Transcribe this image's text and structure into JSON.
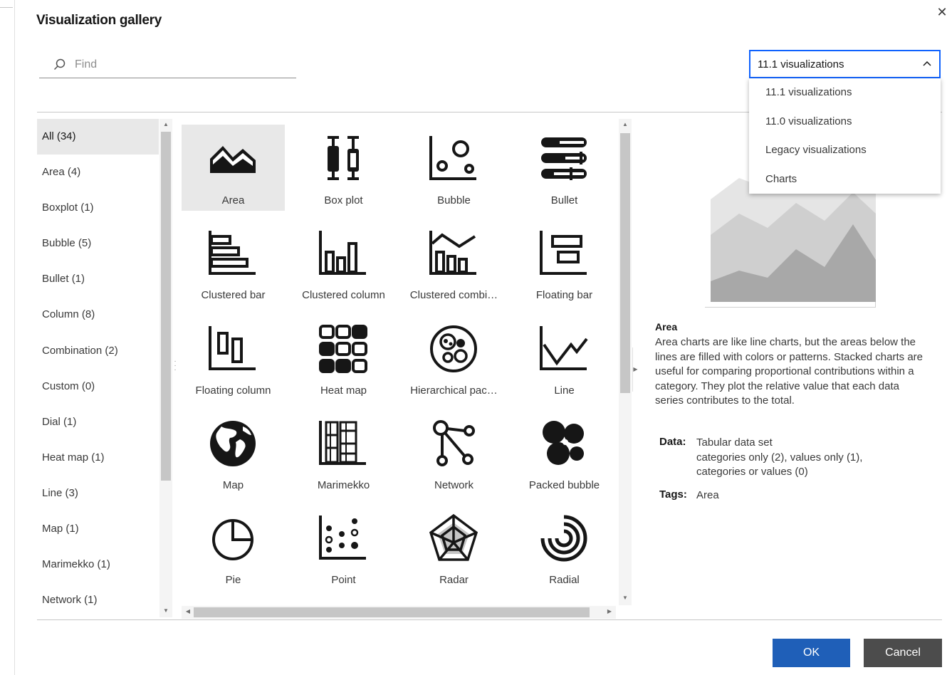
{
  "dialog": {
    "title": "Visualization gallery",
    "close_icon": "close-icon"
  },
  "search": {
    "placeholder": "Find",
    "value": ""
  },
  "version_select": {
    "selected": "11.1 visualizations",
    "expanded": true,
    "options": [
      "11.1 visualizations",
      "11.0 visualizations",
      "Legacy visualizations",
      "Charts"
    ]
  },
  "categories": [
    {
      "label": "All (34)",
      "selected": true
    },
    {
      "label": "Area (4)"
    },
    {
      "label": "Boxplot (1)"
    },
    {
      "label": "Bubble (5)"
    },
    {
      "label": "Bullet (1)"
    },
    {
      "label": "Column (8)"
    },
    {
      "label": "Combination (2)"
    },
    {
      "label": "Custom (0)"
    },
    {
      "label": "Dial (1)"
    },
    {
      "label": "Heat map (1)"
    },
    {
      "label": "Line (3)"
    },
    {
      "label": "Map (1)"
    },
    {
      "label": "Marimekko (1)"
    },
    {
      "label": "Network (1)"
    }
  ],
  "visualizations": [
    {
      "label": "Area",
      "icon": "area-chart-icon",
      "selected": true
    },
    {
      "label": "Box plot",
      "icon": "box-plot-icon"
    },
    {
      "label": "Bubble",
      "icon": "bubble-chart-icon"
    },
    {
      "label": "Bullet",
      "icon": "bullet-chart-icon"
    },
    {
      "label": "Clustered bar",
      "icon": "clustered-bar-icon"
    },
    {
      "label": "Clustered column",
      "icon": "clustered-column-icon"
    },
    {
      "label": "Clustered combi…",
      "icon": "clustered-combination-icon"
    },
    {
      "label": "Floating bar",
      "icon": "floating-bar-icon"
    },
    {
      "label": "Floating column",
      "icon": "floating-column-icon"
    },
    {
      "label": "Heat map",
      "icon": "heat-map-icon"
    },
    {
      "label": "Hierarchical pac…",
      "icon": "hierarchical-packed-bubble-icon"
    },
    {
      "label": "Line",
      "icon": "line-chart-icon"
    },
    {
      "label": "Map",
      "icon": "globe-map-icon"
    },
    {
      "label": "Marimekko",
      "icon": "marimekko-icon"
    },
    {
      "label": "Network",
      "icon": "network-icon"
    },
    {
      "label": "Packed bubble",
      "icon": "packed-bubble-icon"
    },
    {
      "label": "Pie",
      "icon": "pie-chart-icon"
    },
    {
      "label": "Point",
      "icon": "point-chart-icon"
    },
    {
      "label": "Radar",
      "icon": "radar-chart-icon"
    },
    {
      "label": "Radial",
      "icon": "radial-chart-icon"
    }
  ],
  "detail": {
    "title": "Area",
    "description": "Area charts are like line charts, but the areas below the lines are filled with colors or patterns. Stacked charts are useful for comparing proportional contributions within a category. They plot the relative value that each data series contributes to the total.",
    "data_label": "Data:",
    "data_value_line1": "Tabular data set",
    "data_value_line2": "categories only (2),  values only (1),",
    "data_value_line3": "categories or values (0)",
    "tags_label": "Tags:",
    "tags_value": "Area",
    "preview_icon": "area-chart-preview"
  },
  "actions": {
    "ok": "OK",
    "cancel": "Cancel"
  },
  "colors": {
    "primary": "#1f5fb8",
    "secondary": "#4c4c4c",
    "focus": "#0f62fe",
    "selected_bg": "#e8e8e8"
  }
}
